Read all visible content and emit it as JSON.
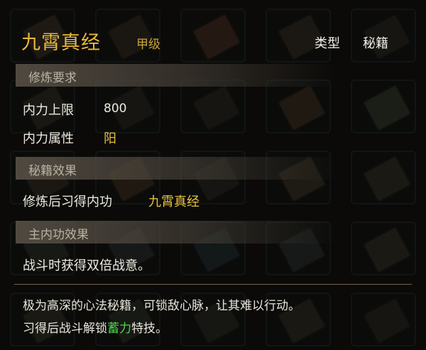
{
  "item": {
    "name": "九霄真经",
    "grade": "甲级",
    "type_label": "类型",
    "type_value": "秘籍"
  },
  "sections": {
    "requirements_header": "修炼要求",
    "effects_header": "秘籍效果",
    "main_effect_header": "主内功效果"
  },
  "requirements": [
    {
      "label": "内力上限",
      "value": "800"
    },
    {
      "label": "内力属性",
      "value": "阳"
    }
  ],
  "effect": {
    "label": "修炼后习得内功",
    "value": "九霄真经"
  },
  "main_effect_text": "战斗时获得双倍战意。",
  "description": {
    "line1": "极为高深的心法秘籍，可锁敌心脉，让其难以行动。",
    "line2_prefix": "习得后战斗解锁",
    "line2_highlight": "蓄力",
    "line2_suffix": "特技。"
  },
  "colors": {
    "title": "#e9b83c",
    "value_gold": "#e9c23c",
    "highlight_green": "#4fd64d",
    "slot_border": "#2a3b3c"
  },
  "background_books": [
    "#5a4a3a",
    "#4a4036",
    "#6a4a32",
    "#4e4638",
    "#3e3a34",
    "#4a4638",
    "#3a3a34",
    "#3c3a32",
    "#5a4a34",
    "#4e5a40",
    "#4e4236",
    "#5a4a30",
    "#3a3c30",
    "#56503a",
    "#4a4a38",
    "#3c4a3a",
    "#3c4a4a",
    "#2e4a4a",
    "#3a4a44",
    "#4a4a36",
    "#4a4a36",
    "#3e4a3a",
    "#3a3e36",
    "#4a4432",
    "#3e3a30"
  ]
}
